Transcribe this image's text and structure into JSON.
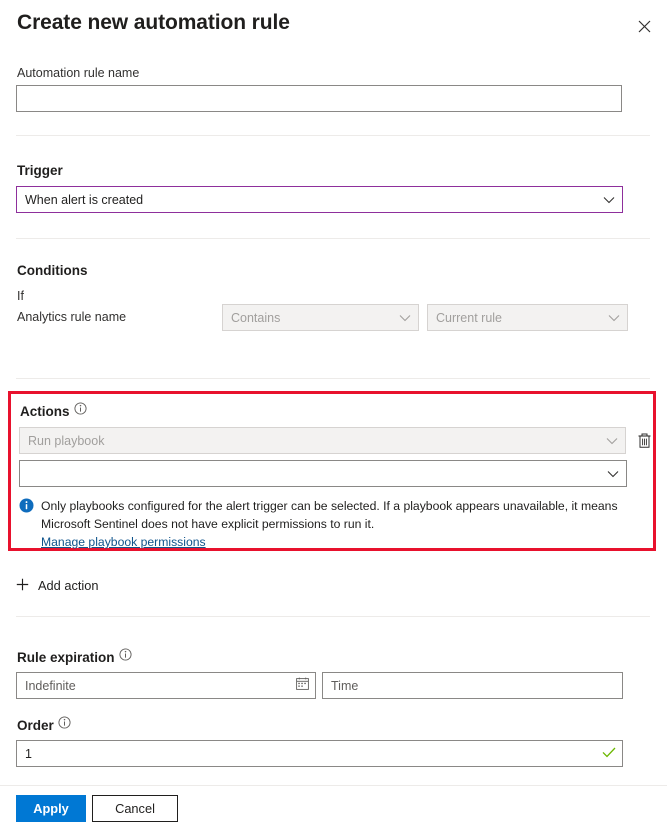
{
  "header": {
    "title": "Create new automation rule",
    "close_icon": "close-icon"
  },
  "rule_name": {
    "label": "Automation rule name",
    "value": "",
    "placeholder": ""
  },
  "trigger": {
    "label": "Trigger",
    "selected": "When alert is created",
    "accent_color": "#8e2f9c",
    "chevron_icon": "chevron-down-icon"
  },
  "conditions": {
    "label": "Conditions",
    "if_label": "If",
    "property_label": "Analytics rule name",
    "operator": "Contains",
    "value": "Current rule",
    "disabled": true
  },
  "actions": {
    "label": "Actions",
    "info_icon": "info-circle-icon",
    "highlight_color": "#e8112d",
    "action_type": "Run playbook",
    "action_type_disabled": true,
    "playbook_value": "",
    "delete_icon": "trash-icon",
    "notice": {
      "icon": "info-filled-icon",
      "text": "Only playbooks configured for the alert trigger can be selected. If a playbook appears unavailable, it means Microsoft Sentinel does not have explicit permissions to run it.",
      "link": "Manage playbook permissions",
      "link_color": "#0f548c"
    },
    "add_action_label": "Add action",
    "add_action_icon": "plus-icon"
  },
  "rule_expiration": {
    "label": "Rule expiration",
    "info_icon": "info-circle-icon",
    "date_placeholder": "Indefinite",
    "date_value": "",
    "calendar_icon": "calendar-icon",
    "time_placeholder": "Time",
    "time_value": ""
  },
  "order": {
    "label": "Order",
    "info_icon": "info-circle-icon",
    "value": "1",
    "valid_icon": "checkmark-icon",
    "valid_color": "#6bb700"
  },
  "footer": {
    "apply_label": "Apply",
    "apply_color": "#0078d4",
    "cancel_label": "Cancel"
  }
}
